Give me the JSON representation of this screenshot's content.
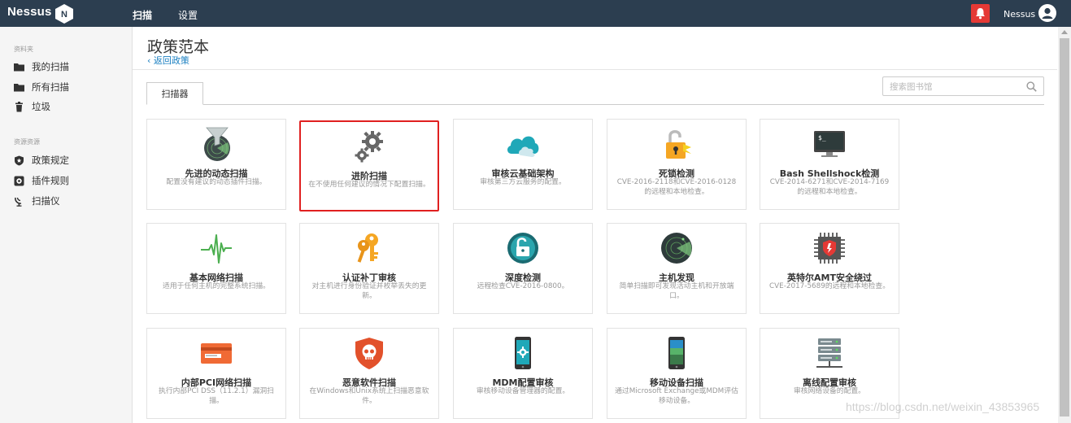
{
  "topbar": {
    "logo": "Nessus",
    "logo_badge": "N",
    "nav": [
      "扫描",
      "设置"
    ],
    "user": "Nessus",
    "accent": "#e53935",
    "bg": "#2c3e50"
  },
  "sidebar": {
    "folders_heading": "资料夹",
    "folders": [
      {
        "label": "我的扫描",
        "icon": "folder-icon"
      },
      {
        "label": "所有扫描",
        "icon": "folder-icon"
      },
      {
        "label": "垃圾",
        "icon": "trash-icon"
      }
    ],
    "resources_heading": "资源资源",
    "resources": [
      {
        "label": "政策规定",
        "icon": "shield-icon"
      },
      {
        "label": "插件规则",
        "icon": "plugin-rules-icon"
      },
      {
        "label": "扫描仪",
        "icon": "scanner-icon"
      }
    ]
  },
  "main": {
    "title": "政策范本",
    "back": "返回政策",
    "tab": "扫描器",
    "search_placeholder": "搜索图书馆"
  },
  "cards": [
    {
      "title": "先进的动态扫描",
      "desc": "配置没有建议的动态插件扫描。",
      "icon": "radar-funnel-icon"
    },
    {
      "title": "进阶扫描",
      "desc": "在不使用任何建议的情况下配置扫描。",
      "icon": "gears-icon",
      "selected": true
    },
    {
      "title": "审核云基础架构",
      "desc": "审核第三方云服务的配置。",
      "icon": "cloud-icon"
    },
    {
      "title": "死锁检测",
      "desc": "CVE-2016-2118和CVE-2016-0128的远程和本地检查。",
      "icon": "padlock-icon"
    },
    {
      "title": "Bash Shellshock检测",
      "desc": "CVE-2014-6271和CVE-2014-7169的远程和本地检查。",
      "icon": "terminal-icon"
    },
    {
      "title": "基本网络扫描",
      "desc": "适用于任何主机的完整系统扫描。",
      "icon": "pulse-icon"
    },
    {
      "title": "认证补丁审核",
      "desc": "对主机进行身份验证并枚举丢失的更新。",
      "icon": "keys-icon"
    },
    {
      "title": "深度检测",
      "desc": "远程检查CVE-2016-0800。",
      "icon": "unlock-circle-icon"
    },
    {
      "title": "主机发现",
      "desc": "简单扫描即可发现活动主机和开放端口。",
      "icon": "radar-icon"
    },
    {
      "title": "英特尔AMT安全绕过",
      "desc": "CVE-2017-5689的远程和本地检查。",
      "icon": "chip-icon"
    },
    {
      "title": "内部PCI网络扫描",
      "desc": "执行内部PCI DSS（11.2.1）漏洞扫描。",
      "icon": "credit-card-icon"
    },
    {
      "title": "恶意软件扫描",
      "desc": "在Windows和Unix系统上扫描恶意软件。",
      "icon": "skull-shield-icon"
    },
    {
      "title": "MDM配置审核",
      "desc": "审核移动设备管理器的配置。",
      "icon": "mobile-gear-icon"
    },
    {
      "title": "移动设备扫描",
      "desc": "通过Microsoft Exchange或MDM评估移动设备。",
      "icon": "mobile-icon"
    },
    {
      "title": "离线配置审核",
      "desc": "审核网络设备的配置。",
      "icon": "server-icon"
    }
  ],
  "watermark": "https://blog.csdn.net/weixin_43853965"
}
